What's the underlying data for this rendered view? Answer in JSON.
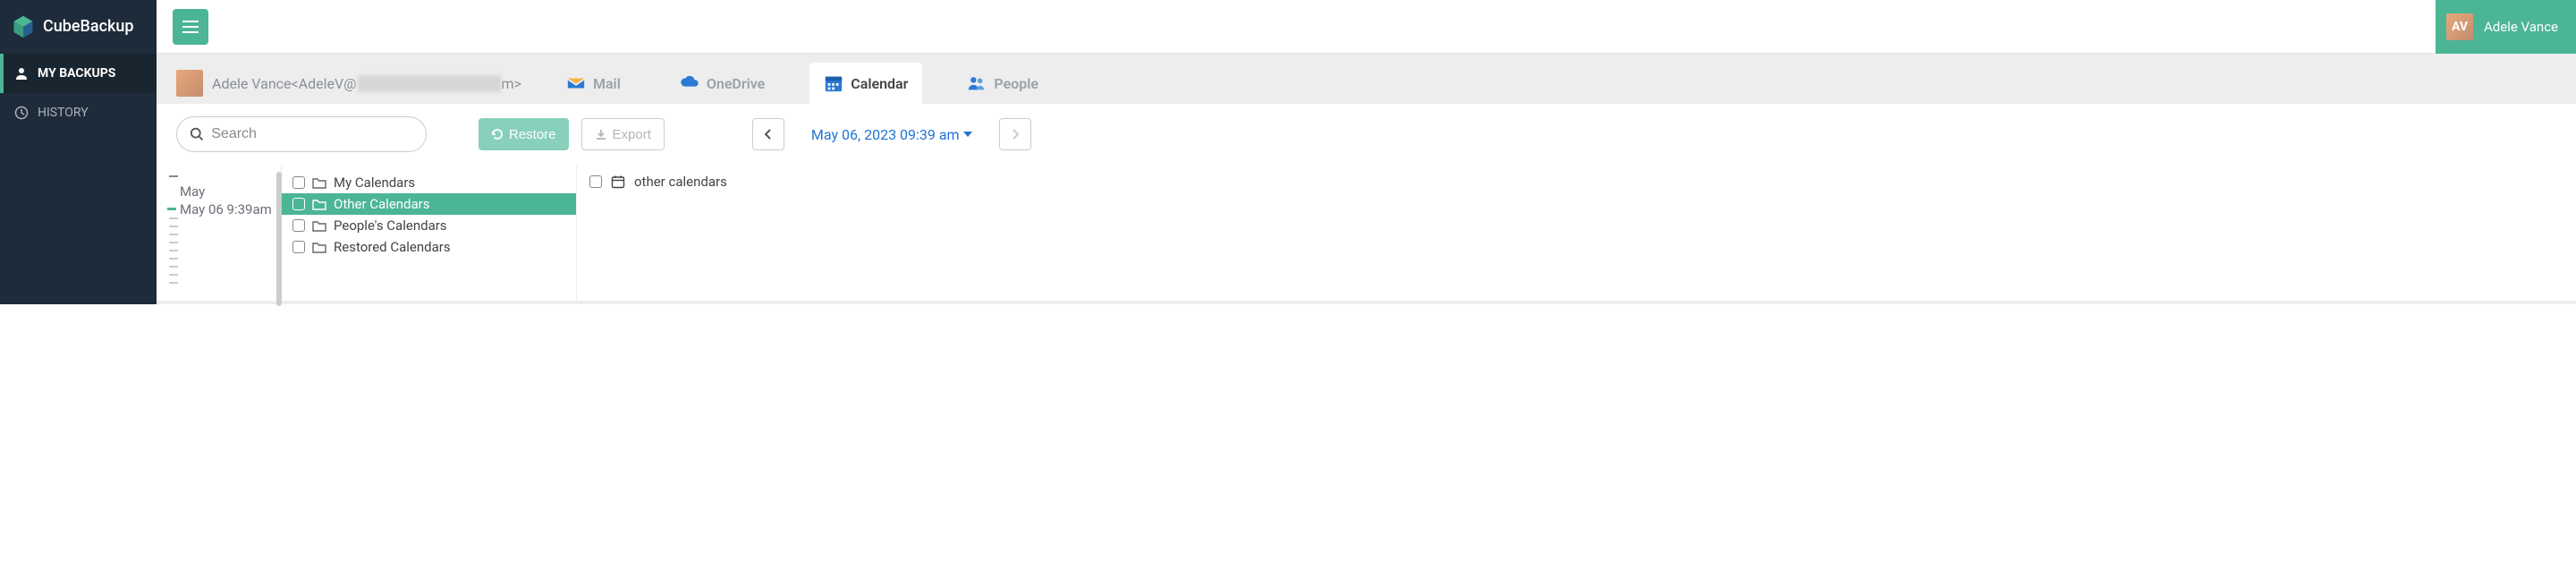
{
  "brand": {
    "name": "CubeBackup"
  },
  "user": {
    "name": "Adele Vance"
  },
  "sidebar": {
    "items": [
      {
        "label": "MY BACKUPS",
        "active": true
      },
      {
        "label": "HISTORY",
        "active": false
      }
    ]
  },
  "breadcrumb": {
    "display_name": "Adele Vance",
    "email_prefix": "<AdeleV@",
    "email_suffix": "m>"
  },
  "tabs": [
    {
      "label": "Mail",
      "active": false
    },
    {
      "label": "OneDrive",
      "active": false
    },
    {
      "label": "Calendar",
      "active": true
    },
    {
      "label": "People",
      "active": false
    }
  ],
  "toolbar": {
    "search_placeholder": "Search",
    "restore_label": "Restore",
    "export_label": "Export",
    "snapshot_date": "May 06, 2023 09:39 am"
  },
  "timeline": {
    "month": "May",
    "entry": "May 06 9:39am"
  },
  "tree": {
    "items": [
      {
        "label": "My Calendars",
        "selected": false
      },
      {
        "label": "Other Calendars",
        "selected": true
      },
      {
        "label": "People's Calendars",
        "selected": false
      },
      {
        "label": "Restored Calendars",
        "selected": false
      }
    ]
  },
  "detail": {
    "items": [
      {
        "label": "other calendars"
      }
    ]
  }
}
